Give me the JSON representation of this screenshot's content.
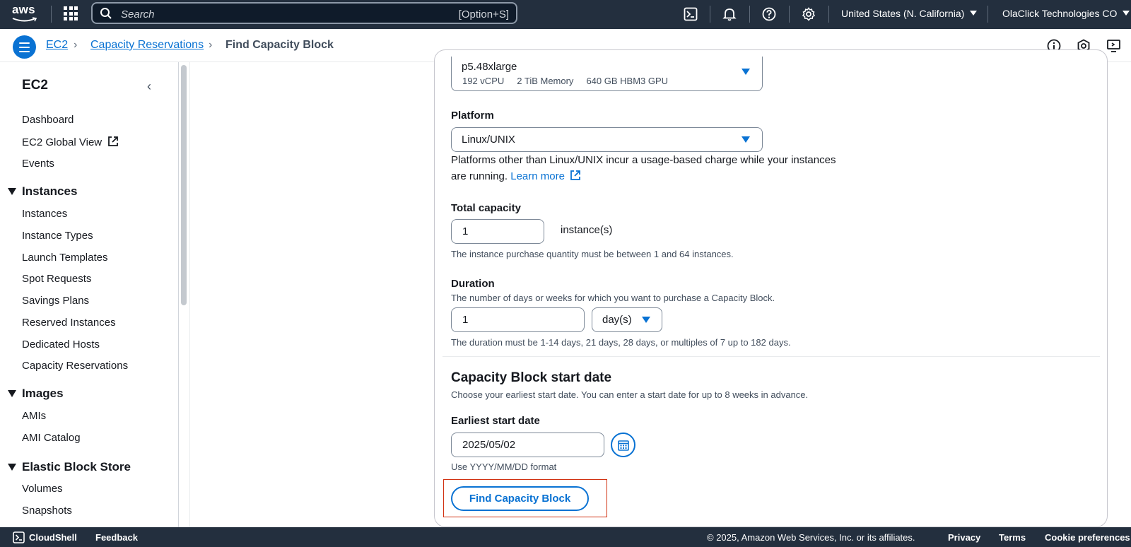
{
  "topbar": {
    "logo_text": "aws",
    "search_placeholder": "Search",
    "search_shortcut": "[Option+S]",
    "region": "United States (N. California)",
    "account": "OlaClick Technologies CO"
  },
  "breadcrumb": {
    "items": [
      "EC2",
      "Capacity Reservations"
    ],
    "current": "Find Capacity Block"
  },
  "sidebar": {
    "title": "EC2",
    "top_items": [
      "Dashboard",
      "EC2 Global View",
      "Events"
    ],
    "sections": [
      {
        "title": "Instances",
        "items": [
          "Instances",
          "Instance Types",
          "Launch Templates",
          "Spot Requests",
          "Savings Plans",
          "Reserved Instances",
          "Dedicated Hosts",
          "Capacity Reservations"
        ]
      },
      {
        "title": "Images",
        "items": [
          "AMIs",
          "AMI Catalog"
        ]
      },
      {
        "title": "Elastic Block Store",
        "items": [
          "Volumes",
          "Snapshots"
        ]
      }
    ]
  },
  "form": {
    "instance_type": {
      "value": "p5.48xlarge",
      "specs": [
        "192 vCPU",
        "2 TiB Memory",
        "640 GB HBM3 GPU"
      ]
    },
    "platform": {
      "label": "Platform",
      "value": "Linux/UNIX",
      "help_line1": "Platforms other than Linux/UNIX incur a usage-based charge while your instances",
      "help_line2": "are running.",
      "learn_more": "Learn more"
    },
    "total_capacity": {
      "label": "Total capacity",
      "value": "1",
      "unit": "instance(s)",
      "help": "The instance purchase quantity must be between 1 and 64 instances."
    },
    "duration": {
      "label": "Duration",
      "description": "The number of days or weeks for which you want to purchase a Capacity Block.",
      "value": "1",
      "unit": "day(s)",
      "help": "The duration must be 1-14 days, 21 days, 28 days, or multiples of 7 up to 182 days."
    },
    "start_date_section": {
      "heading": "Capacity Block start date",
      "description": "Choose your earliest start date. You can enter a start date for up to 8 weeks in advance.",
      "label": "Earliest start date",
      "value": "2025/05/02",
      "help": "Use YYYY/MM/DD format"
    },
    "find_button": "Find Capacity Block"
  },
  "footer": {
    "cloudshell": "CloudShell",
    "feedback": "Feedback",
    "copyright": "© 2025, Amazon Web Services, Inc. or its affiliates.",
    "privacy": "Privacy",
    "terms": "Terms",
    "cookies": "Cookie preferences"
  },
  "colors": {
    "nav_bg": "#232f3e",
    "link": "#0972d3",
    "highlight": "#d13212"
  }
}
